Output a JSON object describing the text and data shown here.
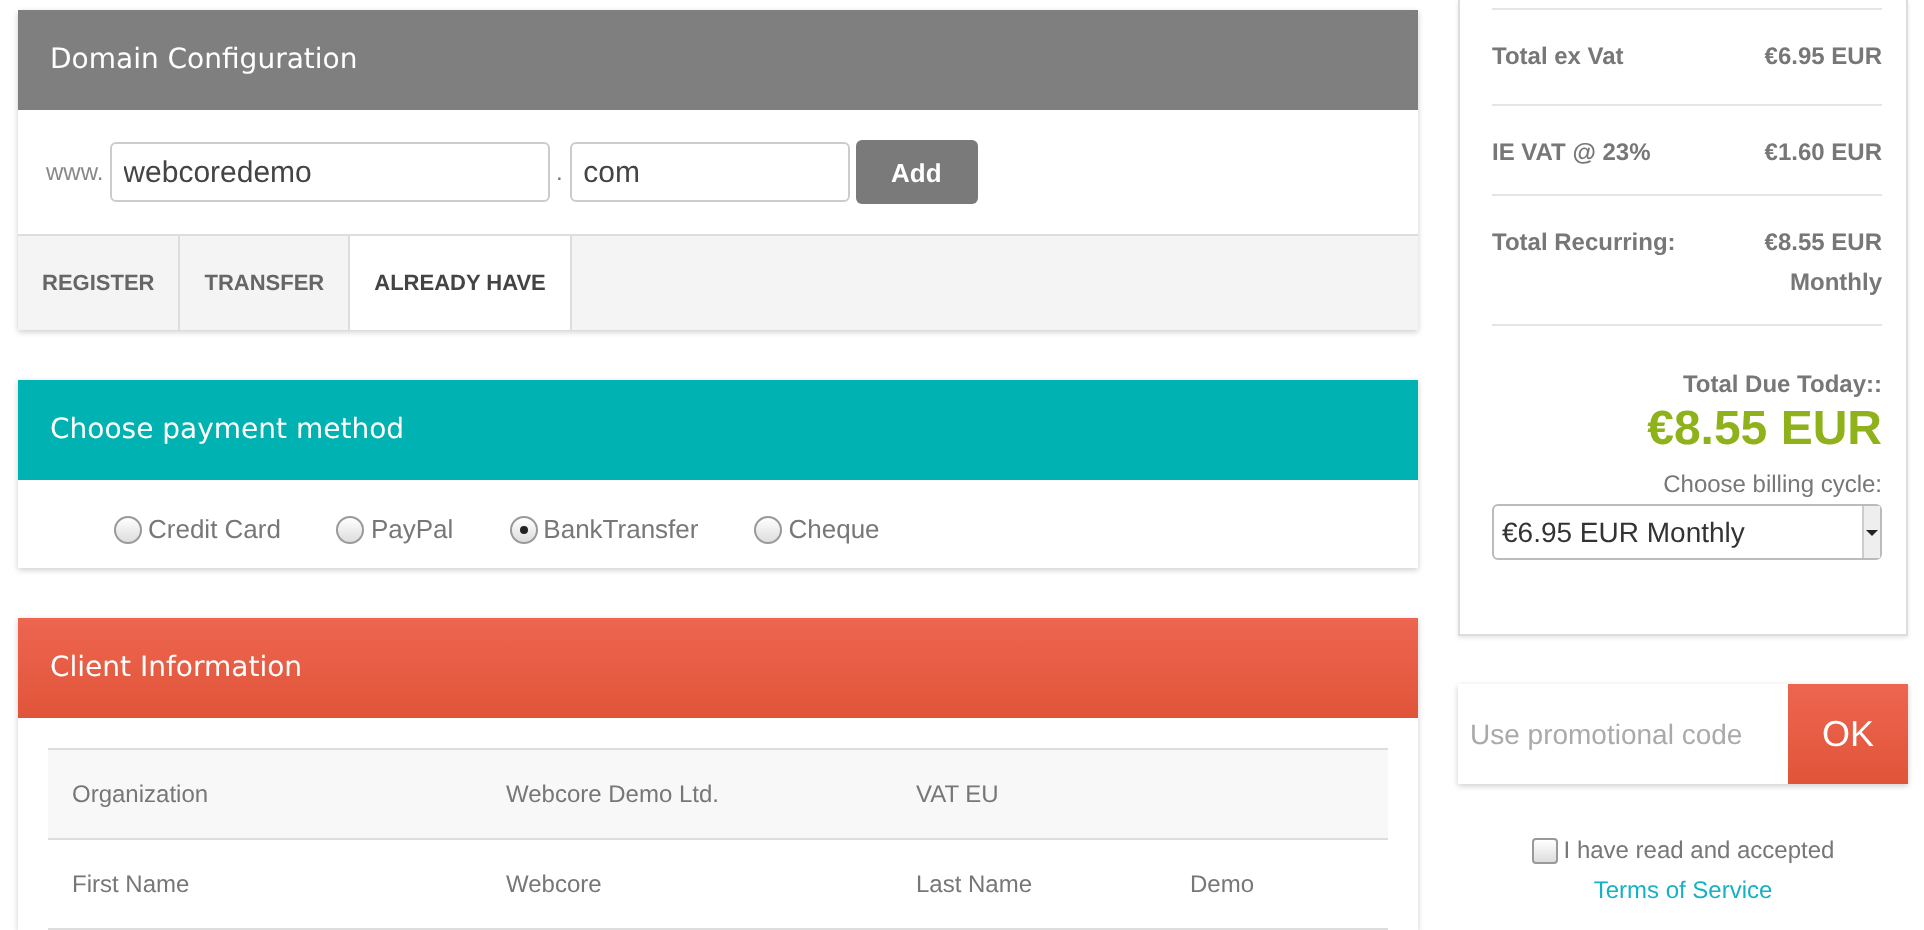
{
  "domain": {
    "title": "Domain Configuration",
    "prefix": "www.",
    "name": "webcoredemo",
    "separator": ".",
    "tld": "com",
    "add_button": "Add",
    "tabs": [
      {
        "label": "REGISTER",
        "selected": false
      },
      {
        "label": "TRANSFER",
        "selected": false
      },
      {
        "label": "ALREADY HAVE",
        "selected": true
      }
    ]
  },
  "payment": {
    "title": "Choose payment method",
    "options": [
      {
        "label": "Credit Card",
        "selected": false
      },
      {
        "label": "PayPal",
        "selected": false
      },
      {
        "label": "BankTransfer",
        "selected": true
      },
      {
        "label": "Cheque",
        "selected": false
      }
    ]
  },
  "client": {
    "title": "Client Information",
    "rows": [
      [
        "Organization",
        "Webcore Demo Ltd.",
        "VAT EU"
      ],
      [
        "First Name",
        "Webcore",
        "Last Name",
        "Demo"
      ]
    ]
  },
  "summary": {
    "lines": [
      {
        "label": "Total ex Vat",
        "value": [
          "€6.95 EUR"
        ]
      },
      {
        "label": "IE VAT @ 23%",
        "value": [
          "€1.60 EUR"
        ]
      },
      {
        "label": "Total Recurring:",
        "value": [
          "€8.55 EUR",
          "Monthly"
        ]
      }
    ],
    "due_label": "Total Due Today::",
    "due_amount": "€8.55 EUR",
    "cycle_label": "Choose billing cycle:",
    "cycle_value": "€6.95 EUR Monthly"
  },
  "promo": {
    "placeholder": "Use promotional code",
    "button": "OK"
  },
  "terms": {
    "checked": false,
    "text": "I have read and accepted",
    "link": "Terms of Service"
  }
}
